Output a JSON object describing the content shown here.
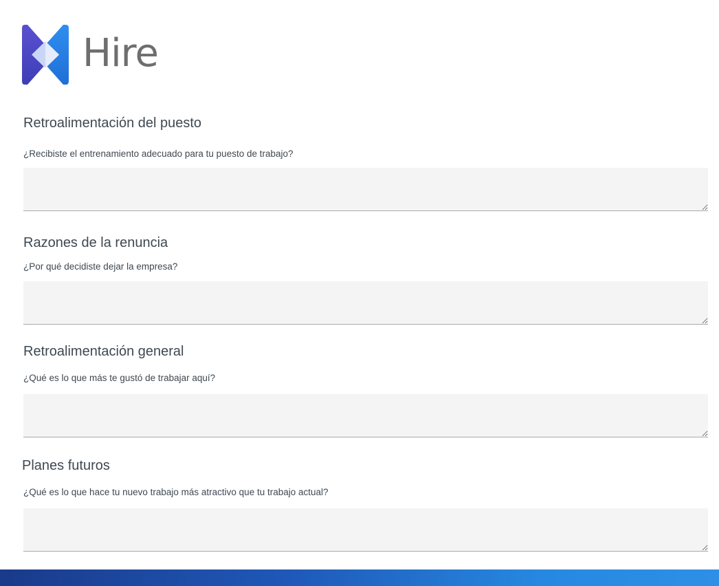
{
  "brand": {
    "name": "Hire",
    "logo_icon": "hire-logo-icon"
  },
  "sections": [
    {
      "title": "Retroalimentación del puesto",
      "question": "¿Recibiste el entrenamiento adecuado para tu puesto de trabajo?",
      "value": ""
    },
    {
      "title": "Razones de la renuncia",
      "question": "¿Por qué decidiste dejar la empresa?",
      "value": ""
    },
    {
      "title": "Retroalimentación general",
      "question": "¿Qué es lo que más te gustó de trabajar aquí?",
      "value": ""
    },
    {
      "title": "Planes futuros",
      "question": "¿Qué es lo que hace tu nuevo trabajo más atractivo que tu trabajo actual?",
      "value": ""
    }
  ],
  "colors": {
    "field_bg": "#f4f4f4",
    "text": "#3e4851",
    "bar_start": "#1a3a8a",
    "bar_end": "#2e8fe6"
  }
}
